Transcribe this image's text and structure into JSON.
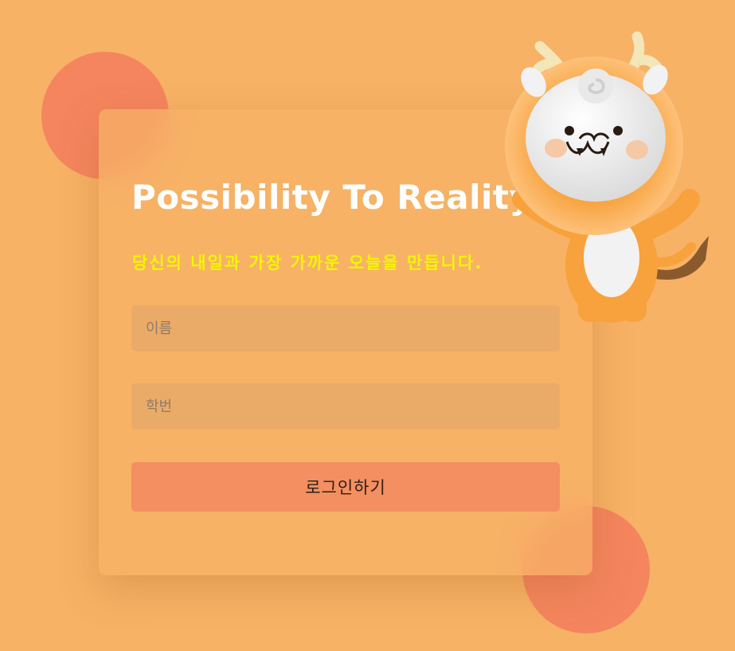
{
  "login": {
    "title": "Possibility To Reality",
    "subtitle": "당신의 내일과 가장 가까운 오늘을 만듭니다.",
    "name_placeholder": "이름",
    "student_id_placeholder": "학번",
    "login_label": "로그인하기"
  },
  "colors": {
    "background": "#f7b266",
    "accent_circle": "#f4855e",
    "subtitle": "#f5f500",
    "button": "#f38f60"
  },
  "icons": {
    "mascot": "dragon-mascot-icon"
  }
}
